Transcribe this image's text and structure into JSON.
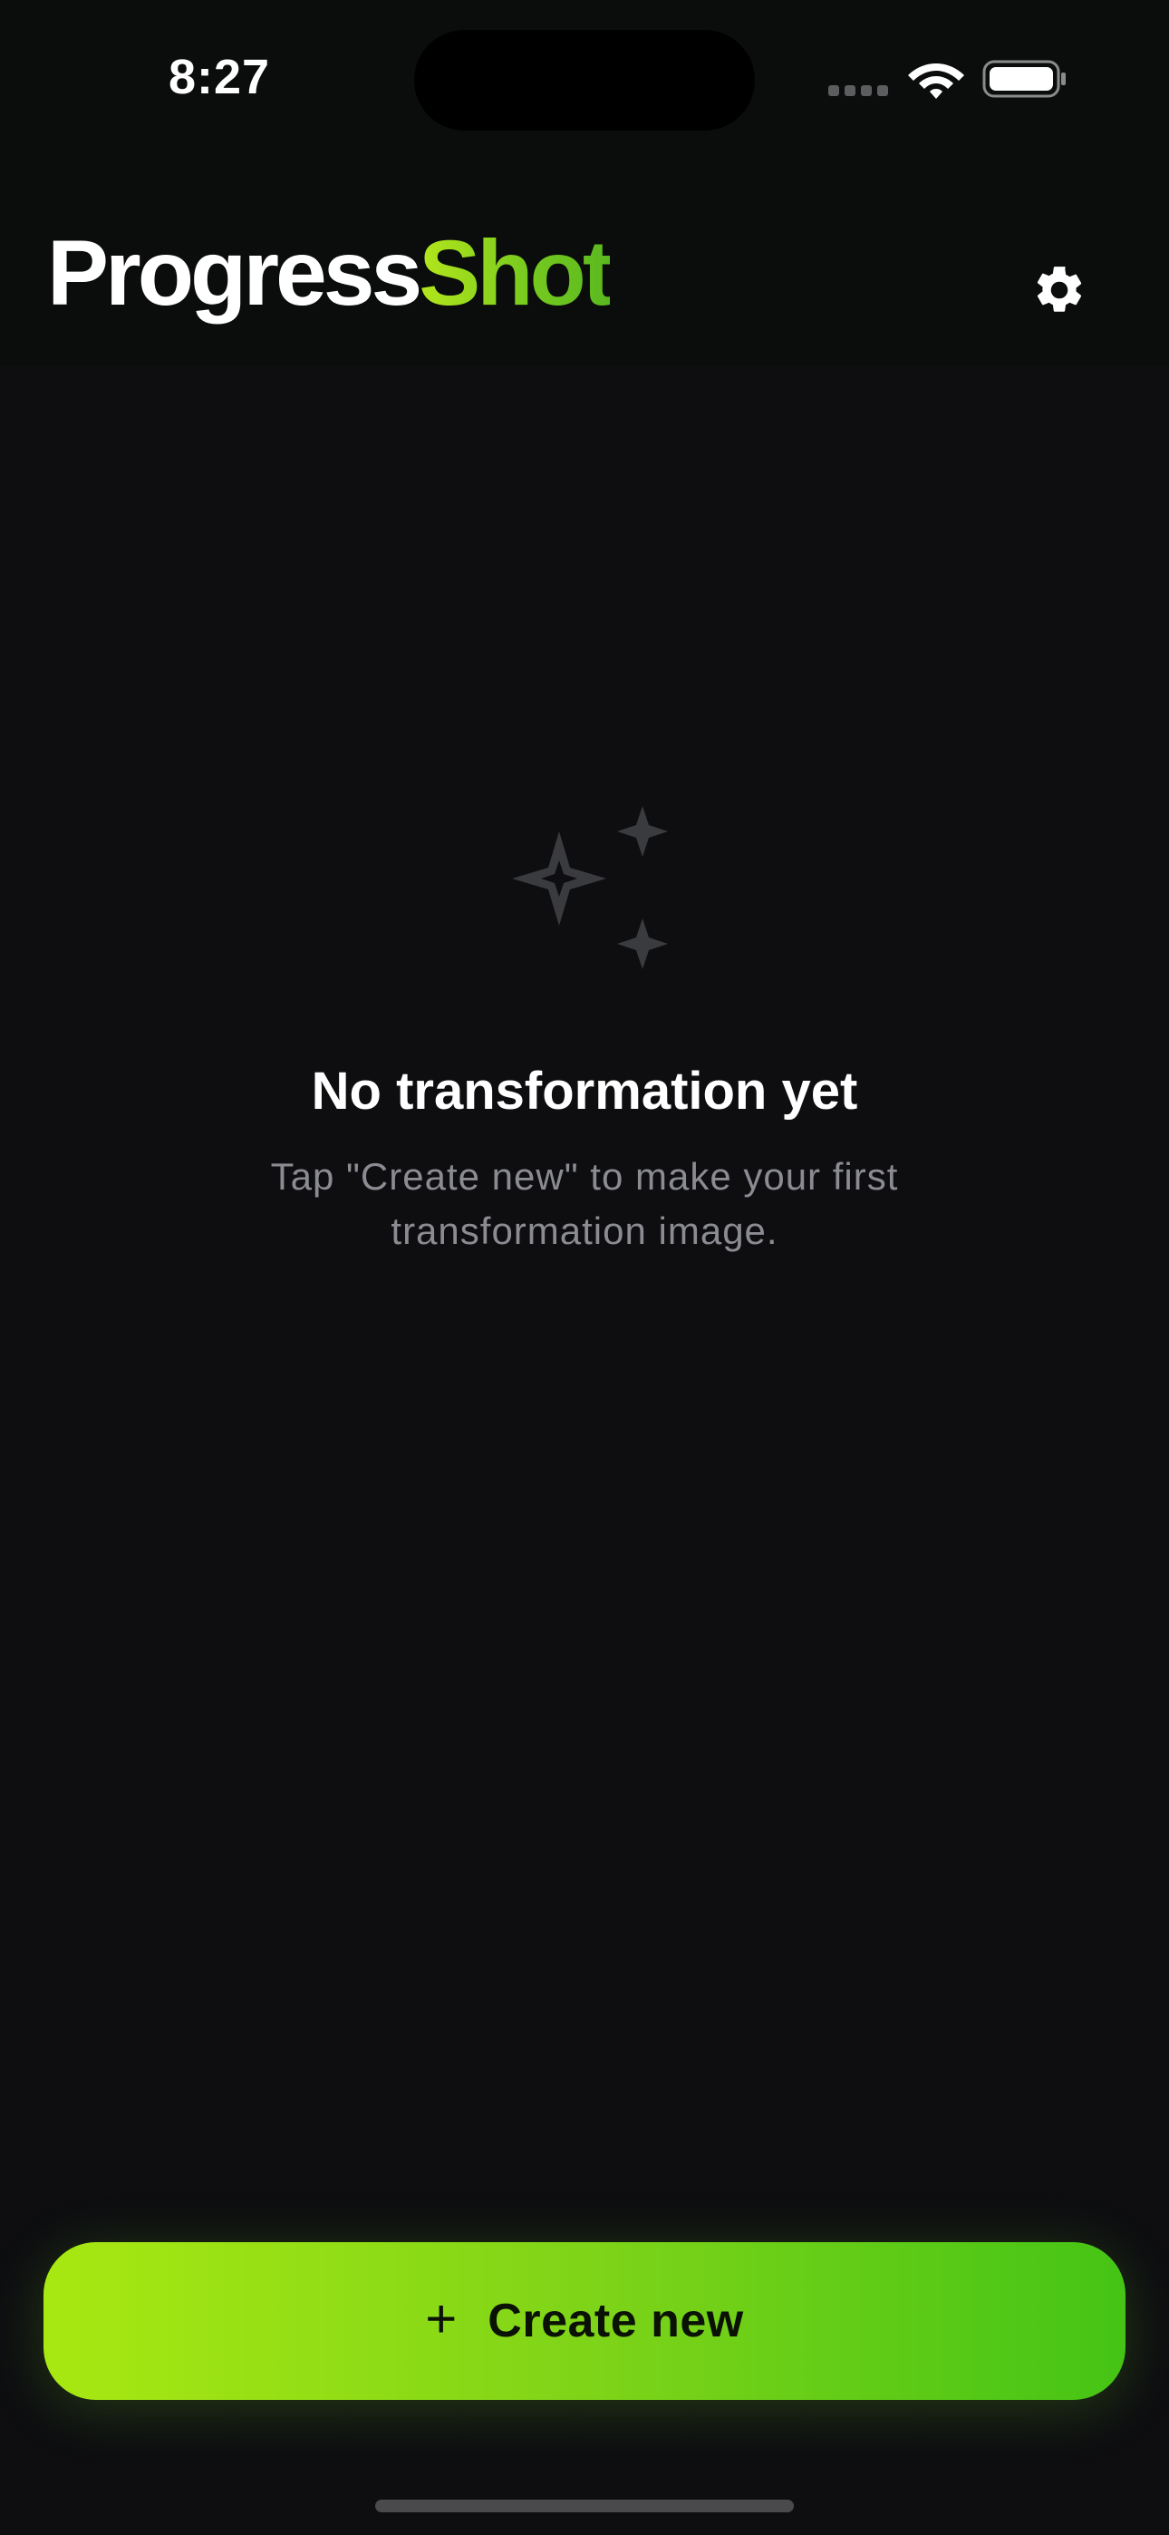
{
  "status_bar": {
    "time": "8:27"
  },
  "header": {
    "logo_part1": "Progress",
    "logo_part2": "Shot",
    "settings_icon": "gear-icon"
  },
  "empty_state": {
    "icon": "sparkles-icon",
    "title": "No transformation yet",
    "description": "Tap \"Create new\" to make your first transformation image."
  },
  "cta": {
    "icon": "+",
    "label": "Create new"
  },
  "colors": {
    "background": "#0e0e11",
    "header_bg": "#0a0d0b",
    "accent_start": "#a8e812",
    "accent_end": "#45c415",
    "muted_text": "#8b8c91",
    "icon_muted": "#3a3b3e"
  }
}
